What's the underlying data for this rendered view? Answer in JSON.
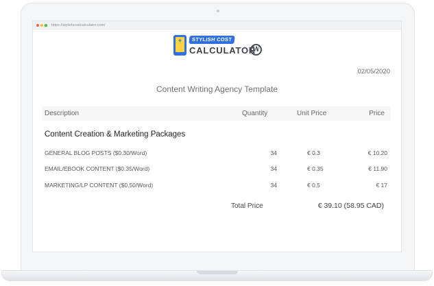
{
  "browser": {
    "url": "https://stylishcostcalculator.com/"
  },
  "logo": {
    "badge": "STYLISH COST",
    "text": "CALCULATOR",
    "phone_glyph": "+"
  },
  "document": {
    "date": "02/05/2020",
    "title": "Content Writing Agency Template"
  },
  "table": {
    "headers": {
      "description": "Description",
      "quantity": "Quantity",
      "unit_price": "Unit Price",
      "price": "Price"
    },
    "section": "Content Creation & Marketing Packages",
    "rows": [
      {
        "description": "GENERAL BLOG POSTS ($0.30/Word)",
        "quantity": "34",
        "unit_price": "€  0.3",
        "price": "€  10.20"
      },
      {
        "description": "EMAIL/EBOOK CONTENT ($0.35/Word)",
        "quantity": "34",
        "unit_price": "€  0.35",
        "price": "€  11.90"
      },
      {
        "description": "MARKETING/LP CONTENT ($0.50/Word)",
        "quantity": "34",
        "unit_price": "€  0.5",
        "price": "€  17"
      }
    ]
  },
  "total": {
    "label": "Total Price",
    "value": "€ 39.10 (58.95 CAD)"
  },
  "icons": {
    "wordpress": "wordpress-icon",
    "phone": "calculator-phone-icon"
  }
}
